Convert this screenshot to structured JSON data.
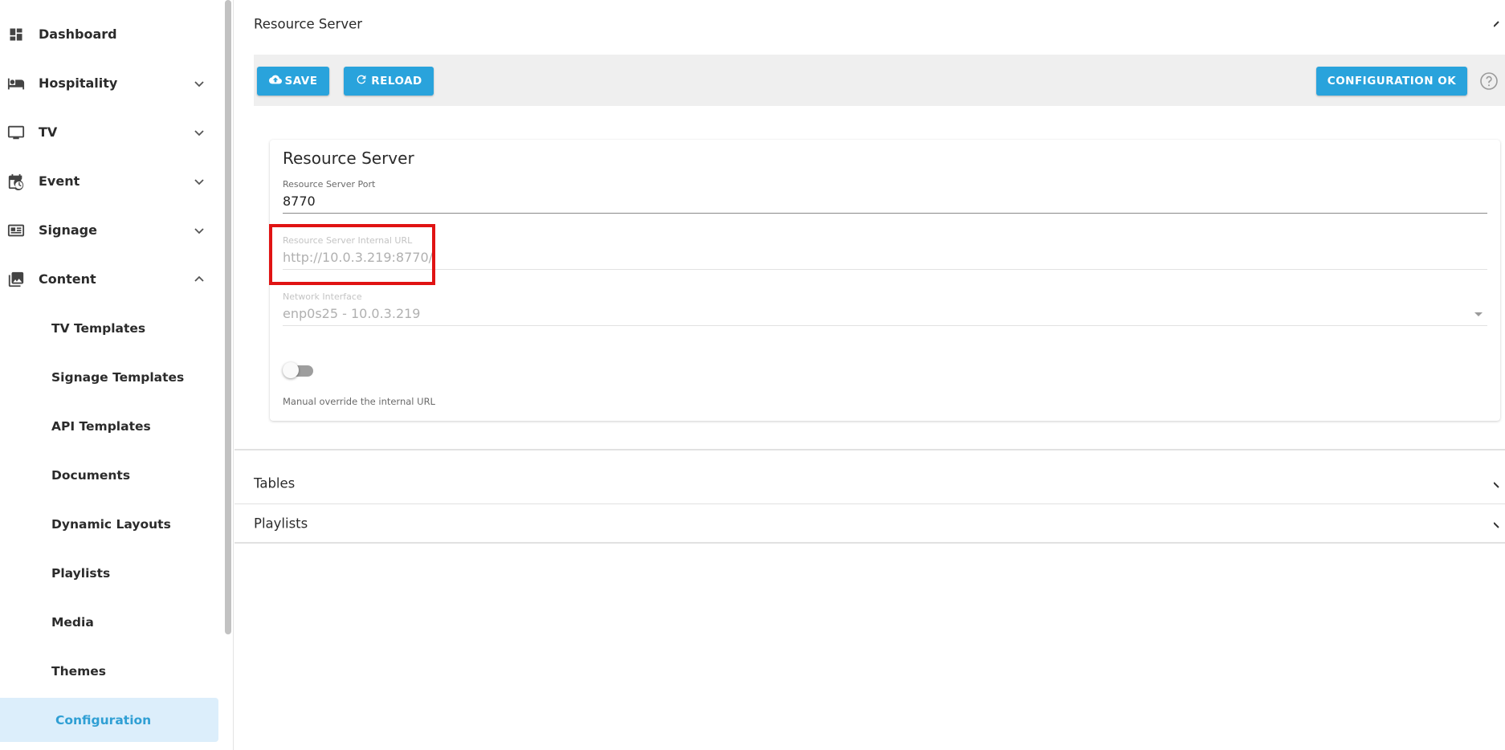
{
  "sidebar": {
    "items": [
      {
        "label": "Dashboard",
        "icon": "dashboard-icon",
        "expandable": false
      },
      {
        "label": "Hospitality",
        "icon": "bed-icon",
        "expandable": true
      },
      {
        "label": "TV",
        "icon": "tv-icon",
        "expandable": true
      },
      {
        "label": "Event",
        "icon": "calendar-clock-icon",
        "expandable": true
      },
      {
        "label": "Signage",
        "icon": "signage-icon",
        "expandable": true
      },
      {
        "label": "Content",
        "icon": "photo-library-icon",
        "expandable": true,
        "expanded": true
      }
    ],
    "content_subitems": [
      {
        "label": "TV Templates"
      },
      {
        "label": "Signage Templates"
      },
      {
        "label": "API Templates"
      },
      {
        "label": "Documents"
      },
      {
        "label": "Dynamic Layouts"
      },
      {
        "label": "Playlists"
      },
      {
        "label": "Media"
      },
      {
        "label": "Themes"
      },
      {
        "label": "Configuration",
        "active": true
      }
    ]
  },
  "main": {
    "resource_panel": {
      "title": "Resource Server",
      "toolbar": {
        "save_label": "SAVE",
        "reload_label": "RELOAD",
        "status_label": "CONFIGURATION OK"
      },
      "card": {
        "title": "Resource Server",
        "port": {
          "label": "Resource Server Port",
          "value": "8770"
        },
        "internal_url": {
          "label": "Resource Server Internal URL",
          "value": "http://10.0.3.219:8770/"
        },
        "network_interface": {
          "label": "Network Interface",
          "value": "enp0s25 - 10.0.3.219"
        },
        "override_toggle": {
          "on": false,
          "caption": "Manual override the internal URL"
        }
      }
    },
    "collapsed_panels": [
      {
        "title": "Tables"
      },
      {
        "title": "Playlists"
      }
    ]
  },
  "colors": {
    "accent": "#29a3dc",
    "active_nav_bg": "#dceefb",
    "active_nav_text": "#2f9fd4",
    "highlight": "#e01313"
  }
}
